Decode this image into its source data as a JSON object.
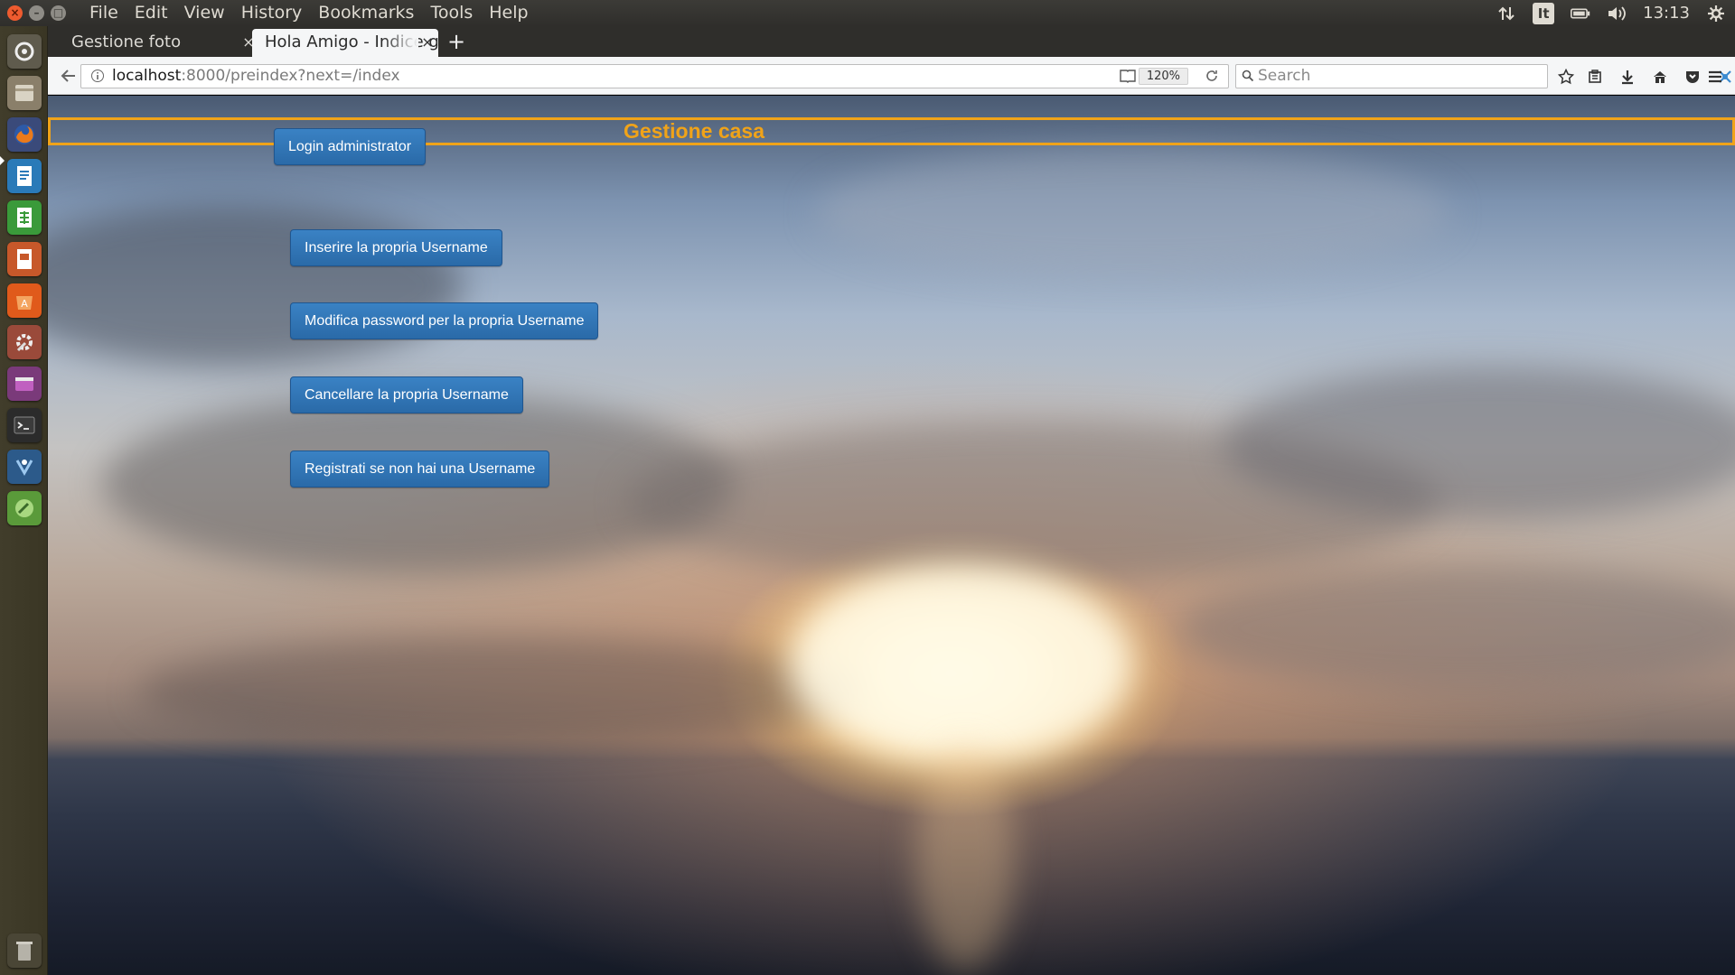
{
  "window": {
    "menu": [
      "File",
      "Edit",
      "View",
      "History",
      "Bookmarks",
      "Tools",
      "Help"
    ],
    "keyboard_layout": "It",
    "clock": "13:13"
  },
  "launcher": {
    "items": [
      {
        "name": "dash-icon",
        "color": "#6e6a5c"
      },
      {
        "name": "files-icon",
        "color": "#8a7f6a"
      },
      {
        "name": "firefox-icon",
        "color": "#e66000"
      },
      {
        "name": "writer-icon",
        "color": "#2a7ab8"
      },
      {
        "name": "calc-icon",
        "color": "#3a9a3a"
      },
      {
        "name": "impress-icon",
        "color": "#c7582a"
      },
      {
        "name": "software-center-icon",
        "color": "#e05a1b"
      },
      {
        "name": "system-settings-icon",
        "color": "#b84a3a"
      },
      {
        "name": "workspace-switcher-icon",
        "color": "#8a3a8a"
      },
      {
        "name": "terminal-icon",
        "color": "#2b2b2b"
      },
      {
        "name": "ide-icon",
        "color": "#2c5a8a"
      },
      {
        "name": "gedit-icon",
        "color": "#5a9a3a"
      }
    ],
    "trash": "trash-icon"
  },
  "tabs": [
    {
      "title": "Gestione foto"
    },
    {
      "title": "Hola Amigo - Indice g"
    }
  ],
  "navbar": {
    "url_host": "localhost",
    "url_rest": ":8000/preindex?next=/index",
    "zoom": "120%",
    "search_placeholder": "Search"
  },
  "page": {
    "title": "Gestione casa",
    "buttons": {
      "login_admin": "Login administrator",
      "insert_username": "Inserire la propria Username",
      "change_password": "Modifica password per la propria Username",
      "delete_username": "Cancellare la propria Username",
      "register": "Registrati se non hai una Username"
    }
  },
  "colors": {
    "accent_orange": "#f0a319",
    "button_blue": "#337ab7"
  }
}
